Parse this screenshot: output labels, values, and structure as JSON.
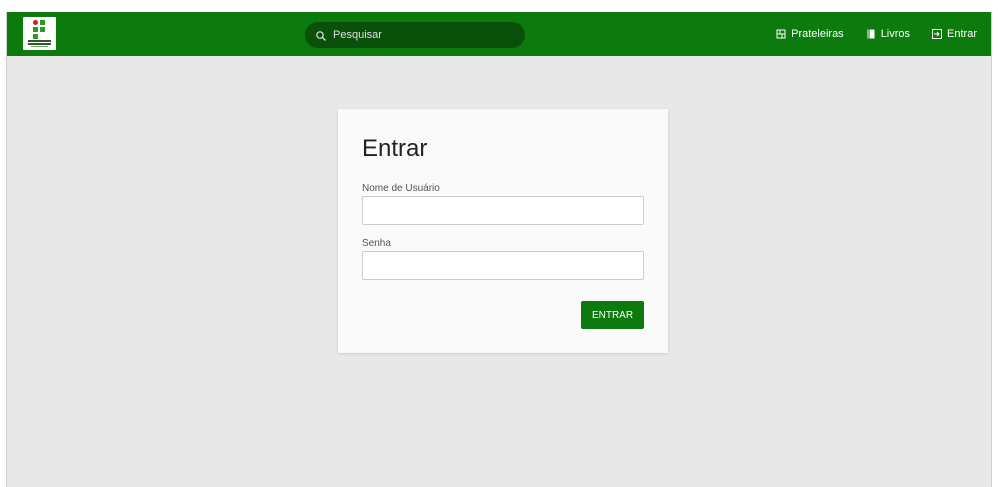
{
  "navbar": {
    "background": "#0c7a0c",
    "logo_icon": "institution-logo",
    "search": {
      "icon": "search-icon",
      "placeholder": "Pesquisar",
      "value": ""
    },
    "links": [
      {
        "label": "Prateleiras",
        "icon": "bookshelf-icon"
      },
      {
        "label": "Livros",
        "icon": "book-icon"
      },
      {
        "label": "Entrar",
        "icon": "login-icon"
      }
    ]
  },
  "login": {
    "title": "Entrar",
    "username_label": "Nome de Usuário",
    "username_value": "",
    "password_label": "Senha",
    "password_value": "",
    "submit_label": "ENTRAR",
    "accent": "#0c7a0c"
  }
}
